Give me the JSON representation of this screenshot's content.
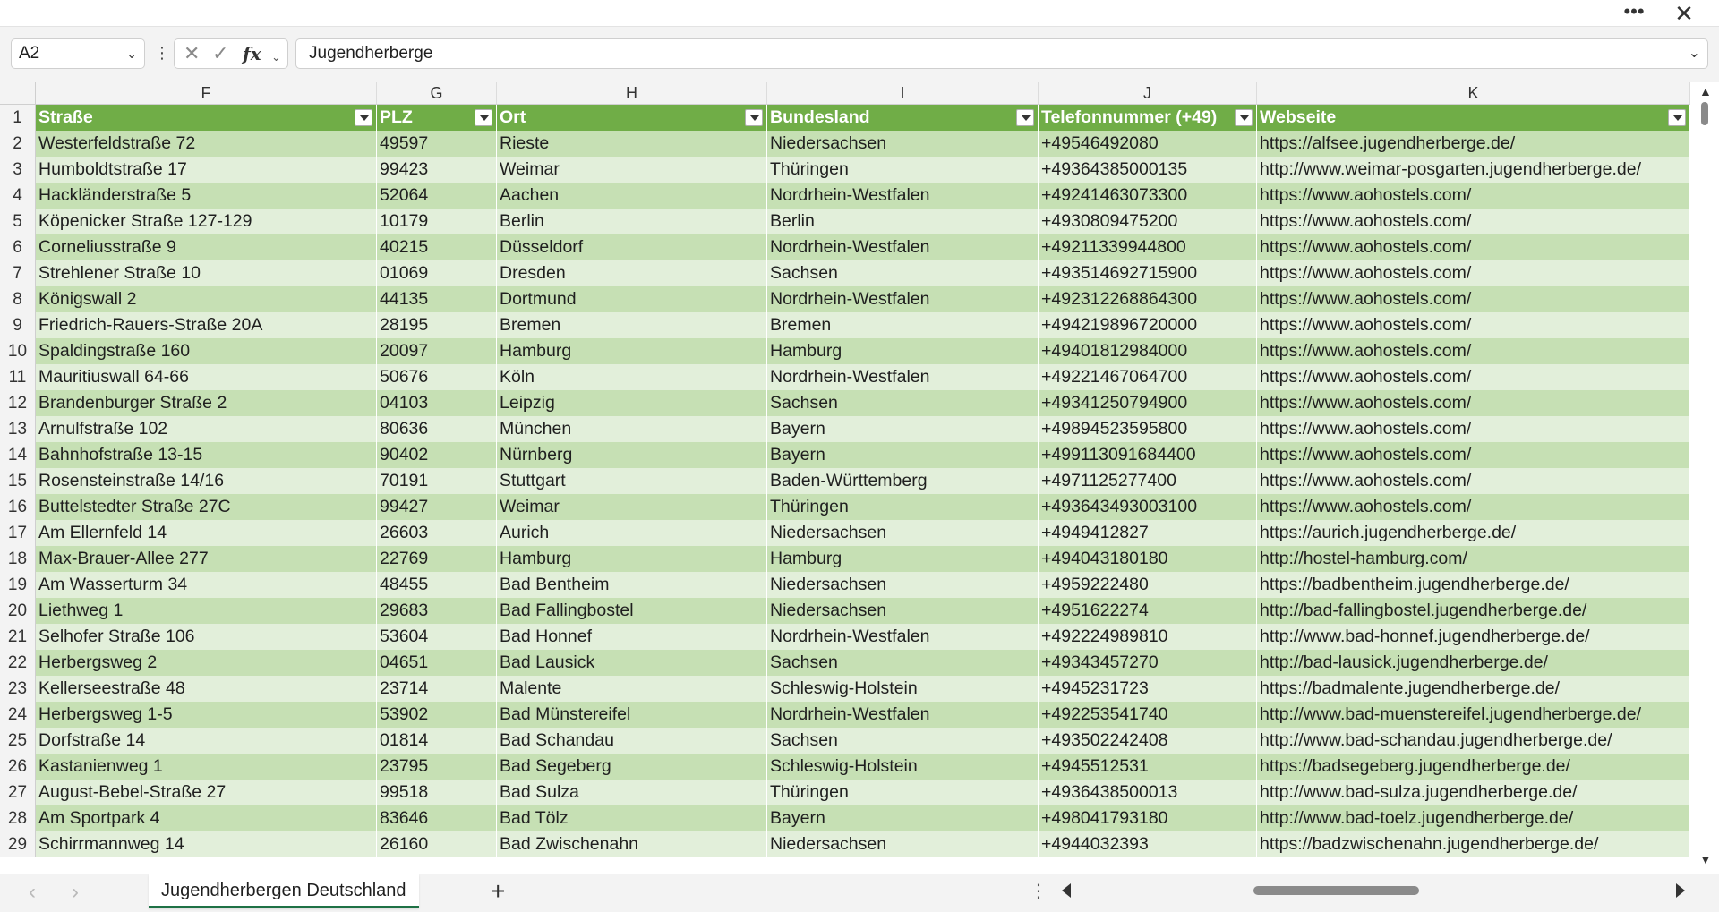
{
  "window": {
    "more_icon": "more-horizontal-icon",
    "close_icon": "close-icon",
    "more_glyph": "•••",
    "close_glyph": "✕"
  },
  "formula_bar": {
    "name_box": "A2",
    "formula": "Jugendherberge"
  },
  "columns": [
    {
      "letter": "F",
      "header": "Straße"
    },
    {
      "letter": "G",
      "header": "PLZ"
    },
    {
      "letter": "H",
      "header": "Ort"
    },
    {
      "letter": "I",
      "header": "Bundesland"
    },
    {
      "letter": "J",
      "header": "Telefonnummer (+49)"
    },
    {
      "letter": "K",
      "header": "Webseite"
    }
  ],
  "header_row_number": "1",
  "rows": [
    {
      "n": "2",
      "cells": [
        "Westerfeldstraße 72",
        "49597",
        "Rieste",
        "Niedersachsen",
        "+49546492080",
        "https://alfsee.jugendherberge.de/"
      ]
    },
    {
      "n": "3",
      "cells": [
        "Humboldtstraße 17",
        "99423",
        "Weimar",
        "Thüringen",
        "+49364385000135",
        "http://www.weimar-posgarten.jugendherberge.de/"
      ]
    },
    {
      "n": "4",
      "cells": [
        "Hackländerstraße 5",
        "52064",
        "Aachen",
        "Nordrhein-Westfalen",
        "+49241463073300",
        "https://www.aohostels.com/"
      ]
    },
    {
      "n": "5",
      "cells": [
        "Köpenicker Straße 127-129",
        "10179",
        "Berlin",
        "Berlin",
        "+4930809475200",
        "https://www.aohostels.com/"
      ]
    },
    {
      "n": "6",
      "cells": [
        "Corneliusstraße 9",
        "40215",
        "Düsseldorf",
        "Nordrhein-Westfalen",
        "+49211339944800",
        "https://www.aohostels.com/"
      ]
    },
    {
      "n": "7",
      "cells": [
        "Strehlener Straße 10",
        "01069",
        "Dresden",
        "Sachsen",
        "+493514692715900",
        "https://www.aohostels.com/"
      ]
    },
    {
      "n": "8",
      "cells": [
        "Königswall 2",
        "44135",
        "Dortmund",
        "Nordrhein-Westfalen",
        "+492312268864300",
        "https://www.aohostels.com/"
      ]
    },
    {
      "n": "9",
      "cells": [
        "Friedrich-Rauers-Straße 20A",
        "28195",
        "Bremen",
        "Bremen",
        "+494219896720000",
        "https://www.aohostels.com/"
      ]
    },
    {
      "n": "10",
      "cells": [
        "Spaldingstraße 160",
        "20097",
        "Hamburg",
        "Hamburg",
        "+49401812984000",
        "https://www.aohostels.com/"
      ]
    },
    {
      "n": "11",
      "cells": [
        "Mauritiuswall 64-66",
        "50676",
        "Köln",
        "Nordrhein-Westfalen",
        "+49221467064700",
        "https://www.aohostels.com/"
      ]
    },
    {
      "n": "12",
      "cells": [
        "Brandenburger Straße 2",
        "04103",
        "Leipzig",
        "Sachsen",
        "+49341250794900",
        "https://www.aohostels.com/"
      ]
    },
    {
      "n": "13",
      "cells": [
        "Arnulfstraße 102",
        "80636",
        "München",
        "Bayern",
        "+49894523595800",
        "https://www.aohostels.com/"
      ]
    },
    {
      "n": "14",
      "cells": [
        "Bahnhofstraße 13-15",
        "90402",
        "Nürnberg",
        "Bayern",
        "+499113091684400",
        "https://www.aohostels.com/"
      ]
    },
    {
      "n": "15",
      "cells": [
        "Rosensteinstraße 14/16",
        "70191",
        "Stuttgart",
        "Baden-Württemberg",
        "+4971125277400",
        "https://www.aohostels.com/"
      ]
    },
    {
      "n": "16",
      "cells": [
        "Buttelstedter Straße 27C",
        "99427",
        "Weimar",
        "Thüringen",
        "+493643493003100",
        "https://www.aohostels.com/"
      ]
    },
    {
      "n": "17",
      "cells": [
        "Am Ellernfeld 14",
        "26603",
        "Aurich",
        "Niedersachsen",
        "+4949412827",
        "https://aurich.jugendherberge.de/"
      ]
    },
    {
      "n": "18",
      "cells": [
        "Max-Brauer-Allee 277",
        "22769",
        "Hamburg",
        "Hamburg",
        "+494043180180",
        "http://hostel-hamburg.com/"
      ]
    },
    {
      "n": "19",
      "cells": [
        "Am Wasserturm 34",
        "48455",
        "Bad Bentheim",
        "Niedersachsen",
        "+4959222480",
        "https://badbentheim.jugendherberge.de/"
      ]
    },
    {
      "n": "20",
      "cells": [
        "Liethweg 1",
        "29683",
        "Bad Fallingbostel",
        "Niedersachsen",
        "+4951622274",
        "http://bad-fallingbostel.jugendherberge.de/"
      ]
    },
    {
      "n": "21",
      "cells": [
        "Selhofer Straße 106",
        "53604",
        "Bad Honnef",
        "Nordrhein-Westfalen",
        "+492224989810",
        "http://www.bad-honnef.jugendherberge.de/"
      ]
    },
    {
      "n": "22",
      "cells": [
        "Herbergsweg 2",
        "04651",
        "Bad Lausick",
        "Sachsen",
        "+49343457270",
        "http://bad-lausick.jugendherberge.de/"
      ]
    },
    {
      "n": "23",
      "cells": [
        "Kellerseestraße 48",
        "23714",
        "Malente",
        "Schleswig-Holstein",
        "+4945231723",
        "https://badmalente.jugendherberge.de/"
      ]
    },
    {
      "n": "24",
      "cells": [
        "Herbergsweg 1-5",
        "53902",
        "Bad Münstereifel",
        "Nordrhein-Westfalen",
        "+492253541740",
        "http://www.bad-muenstereifel.jugendherberge.de/"
      ]
    },
    {
      "n": "25",
      "cells": [
        "Dorfstraße 14",
        "01814",
        "Bad Schandau",
        "Sachsen",
        "+493502242408",
        "http://www.bad-schandau.jugendherberge.de/"
      ]
    },
    {
      "n": "26",
      "cells": [
        "Kastanienweg 1",
        "23795",
        "Bad Segeberg",
        "Schleswig-Holstein",
        "+4945512531",
        "https://badsegeberg.jugendherberge.de/"
      ]
    },
    {
      "n": "27",
      "cells": [
        "August-Bebel-Straße 27",
        "99518",
        "Bad Sulza",
        "Thüringen",
        "+4936438500013",
        "http://www.bad-sulza.jugendherberge.de/"
      ]
    },
    {
      "n": "28",
      "cells": [
        "Am Sportpark 4",
        "83646",
        "Bad Tölz",
        "Bayern",
        "+498041793180",
        "http://www.bad-toelz.jugendherberge.de/"
      ]
    },
    {
      "n": "29",
      "cells": [
        "Schirrmannweg 14",
        "26160",
        "Bad Zwischenahn",
        "Niedersachsen",
        "+4944032393",
        "https://badzwischenahn.jugendherberge.de/"
      ]
    }
  ],
  "sheets": [
    {
      "name": "Jugendherbergen Deutschland",
      "active": true
    }
  ],
  "colors": {
    "header": "#70ad47",
    "band_a": "#c6e0b4",
    "band_b": "#e2efda",
    "active_tab_underline": "#1e7145"
  },
  "icons": {
    "namebox_dropdown": "chevron-down-icon",
    "cancel": "x-icon",
    "enter": "check-icon",
    "function": "fx-icon",
    "formula_expand": "chevron-down-icon",
    "filter": "filter-dropdown-icon",
    "add_sheet": "plus-icon",
    "namebox_dd_glyph": "⌄",
    "fb_dots_glyph": "⋮",
    "cancel_glyph": "✕",
    "enter_glyph": "✓",
    "fx_glyph": "fx",
    "fx_dd_glyph": "⌄",
    "formula_dd_glyph": "⌄",
    "vscroll_up_glyph": "▲",
    "vscroll_down_glyph": "▼",
    "nav_prev_glyph": "‹",
    "nav_next_glyph": "›",
    "add_sheet_glyph": "+",
    "sheet_dots_glyph": "⋮"
  }
}
